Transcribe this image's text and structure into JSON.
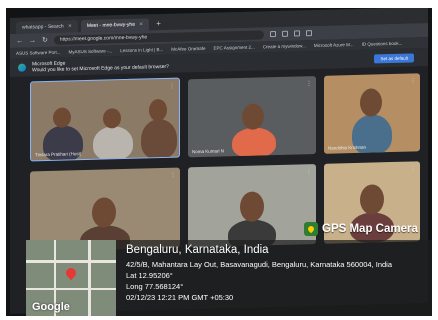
{
  "browser": {
    "tabs": [
      {
        "label": "whatsapp - Search",
        "active": false
      },
      {
        "label": "Meet - mne-bvwy-yhe",
        "active": true
      }
    ],
    "new_tab_symbol": "+",
    "url": "https://meet.google.com/mne-bvwy-yhe",
    "bookmarks": [
      "ASUS Software Port...",
      "MyASUS Software -...",
      "Lessons in Light | B...",
      "McAfee OneSafe",
      "EPC Assignment 2...",
      "Create a mywindow...",
      "Microsoft Azure M...",
      "ID Questions book..."
    ],
    "edge_prompt": {
      "title": "Microsoft Edge",
      "message": "Would you like to set Microsoft Edge as your default browser?",
      "button": "Set as default"
    }
  },
  "meeting": {
    "participants": [
      {
        "name": "Tinsara Pratihari (Host)"
      },
      {
        "name": "Noma Kumari N"
      },
      {
        "name": "Nandithia Krishnan"
      },
      {
        "name": ""
      },
      {
        "name": ""
      },
      {
        "name": ""
      }
    ]
  },
  "gps_stamp": {
    "brand": "GPS Map Camera",
    "city": "Bengaluru, Karnataka, India",
    "address": "42/5/B, Mahantara Lay Out, Basavanagudi, Bengaluru, Karnataka 560004, India",
    "lat": "Lat 12.95206°",
    "long": "Long 77.568124°",
    "datetime": "02/12/23 12:21 PM GMT +05:30",
    "map_brand": "Google"
  },
  "colors": {
    "gps_brand_green": "#2e7d32",
    "map_pin_red": "#e53935",
    "edge_button_blue": "#3b77d8",
    "meet_tile_gray": "#3e4246"
  }
}
